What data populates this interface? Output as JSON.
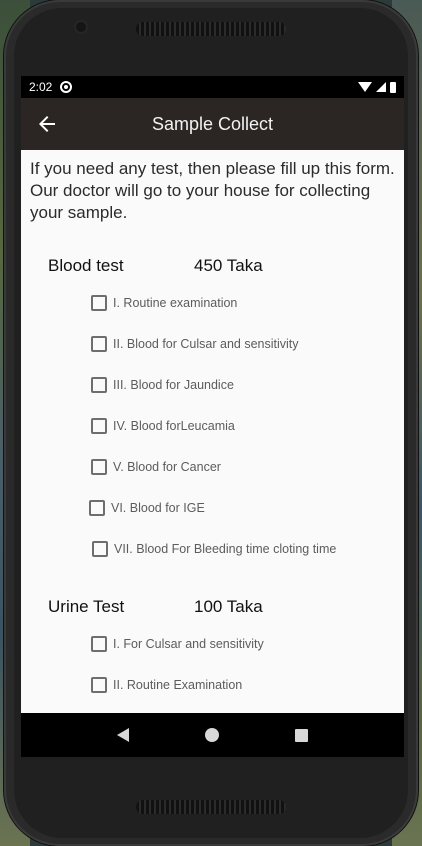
{
  "status_bar": {
    "time": "2:02",
    "icons": [
      "sync-icon",
      "wifi-icon",
      "signal-icon",
      "battery-icon"
    ]
  },
  "app_bar": {
    "title": "Sample Collect",
    "back_icon": "arrow-left-icon"
  },
  "intro_text": "If you need any test, then please fill up this form. Our doctor will go to your house for collecting your sample.",
  "sections": [
    {
      "name": "Blood test",
      "price": "450 Taka",
      "items": [
        {
          "label": "I. Routine examination",
          "checked": false
        },
        {
          "label": "II. Blood for Culsar and sensitivity",
          "checked": false
        },
        {
          "label": "III. Blood for Jaundice",
          "checked": false
        },
        {
          "label": "IV. Blood forLeucamia",
          "checked": false
        },
        {
          "label": "V. Blood for Cancer",
          "checked": false
        },
        {
          "label": "VI. Blood for IGE",
          "checked": false
        },
        {
          "label": "VII. Blood For Bleeding time cloting time",
          "checked": false
        }
      ]
    },
    {
      "name": "Urine Test",
      "price": "100 Taka",
      "items": [
        {
          "label": "I. For Culsar and sensitivity",
          "checked": false
        },
        {
          "label": "II. Routine Examination",
          "checked": false
        }
      ]
    }
  ],
  "nav_bar": {
    "icons": [
      "nav-back-icon",
      "nav-home-icon",
      "nav-recents-icon"
    ]
  },
  "colors": {
    "app_bar": "#2b2624",
    "content_bg": "#fafafa",
    "checkbox_border": "#6e6e6e"
  }
}
